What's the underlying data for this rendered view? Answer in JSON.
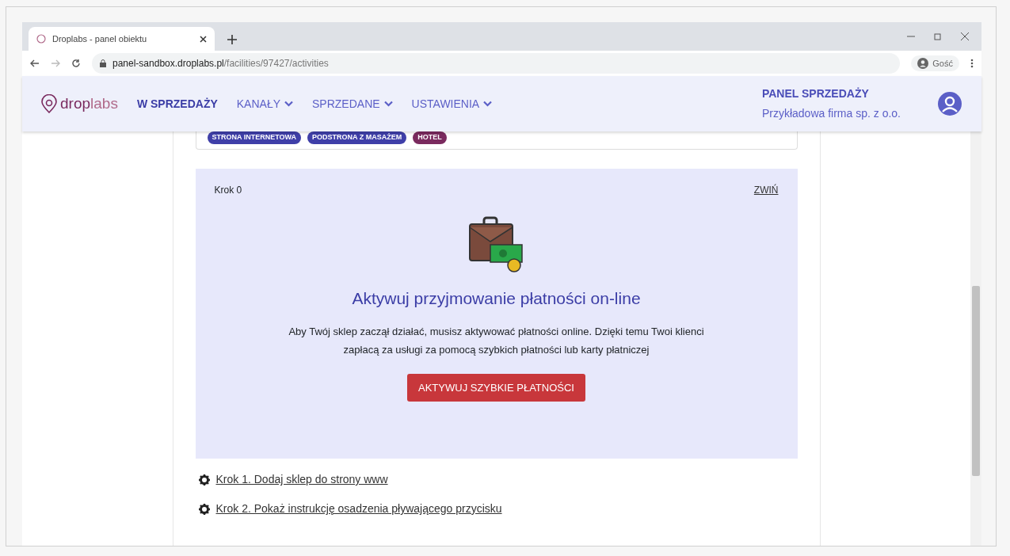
{
  "browser": {
    "tab_title": "Droplabs - panel obiektu",
    "url_host": "panel-sandbox.droplabs.pl",
    "url_path": "/facilities/97427/activities",
    "profile": "Gość"
  },
  "navbar": {
    "logo_a": "drop",
    "logo_b": "labs",
    "items": [
      {
        "label": "W SPRZEDAŻY",
        "selected": true,
        "dropdown": false
      },
      {
        "label": "KANAŁY",
        "selected": false,
        "dropdown": true
      },
      {
        "label": "SPRZEDANE",
        "selected": false,
        "dropdown": true
      },
      {
        "label": "USTAWIENIA",
        "selected": false,
        "dropdown": true
      }
    ],
    "panel_title": "PANEL SPRZEDAŻY",
    "company": "Przykładowa firma sp. z o.o."
  },
  "tags": [
    {
      "label": "STRONA INTERNETOWA",
      "color": "#3f3fa8"
    },
    {
      "label": "PODSTRONA Z MASAŻEM",
      "color": "#3f3fa8"
    },
    {
      "label": "HOTEL",
      "color": "#7a2a5e"
    }
  ],
  "step": {
    "label": "Krok 0",
    "collapse": "ZWIŃ",
    "title": "Aktywuj przyjmowanie płatności on-line",
    "text": "Aby Twój sklep zaczął działać, musisz aktywować płatności online. Dzięki temu Twoi klienci zapłacą za usługi za pomocą szybkich płatności lub karty płatniczej",
    "button": "AKTYWUJ SZYBKIE PŁATNOŚCI"
  },
  "steps": [
    {
      "label": "Krok 1. Dodaj sklep do strony www"
    },
    {
      "label": "Krok 2. Pokaż instrukcję osadzenia pływającego przycisku"
    }
  ]
}
